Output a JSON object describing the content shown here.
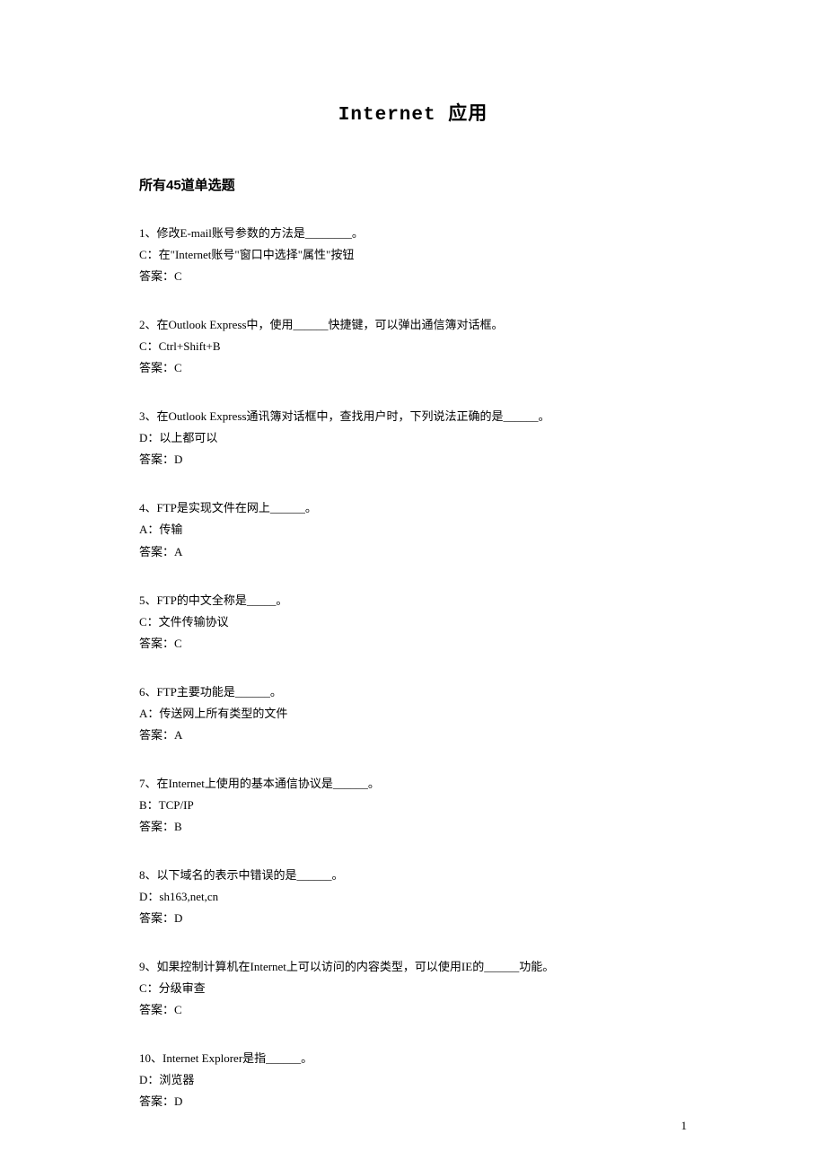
{
  "title": "Internet 应用",
  "section_header": "所有45道单选题",
  "page_number": "1",
  "questions": [
    {
      "q": "1、修改E-mail账号参数的方法是________。",
      "opt": "C：在\"Internet账号\"窗口中选择\"属性\"按钮",
      "ans": "答案：C"
    },
    {
      "q": "2、在Outlook Express中，使用______快捷键，可以弹出通信簿对话框。",
      "opt": "C：Ctrl+Shift+B",
      "ans": "答案：C"
    },
    {
      "q": "3、在Outlook Express通讯簿对话框中，查找用户时，下列说法正确的是______。",
      "opt": "D：以上都可以",
      "ans": "答案：D"
    },
    {
      "q": "4、FTP是实现文件在网上______。",
      "opt": "A：传输",
      "ans": "答案：A"
    },
    {
      "q": "5、FTP的中文全称是_____。",
      "opt": "C：文件传输协议",
      "ans": "答案：C"
    },
    {
      "q": "6、FTP主要功能是______。",
      "opt": "A：传送网上所有类型的文件",
      "ans": "答案：A"
    },
    {
      "q": "7、在Internet上使用的基本通信协议是______。",
      "opt": "B：TCP/IP",
      "ans": "答案：B"
    },
    {
      "q": "8、以下域名的表示中错误的是______。",
      "opt": "D：sh163,net,cn",
      "ans": "答案：D"
    },
    {
      "q": "9、如果控制计算机在Internet上可以访问的内容类型，可以使用IE的______功能。",
      "opt": "C：分级审查",
      "ans": "答案：C"
    },
    {
      "q": "10、Internet Explorer是指______。",
      "opt": "D：浏览器",
      "ans": "答案：D"
    }
  ]
}
